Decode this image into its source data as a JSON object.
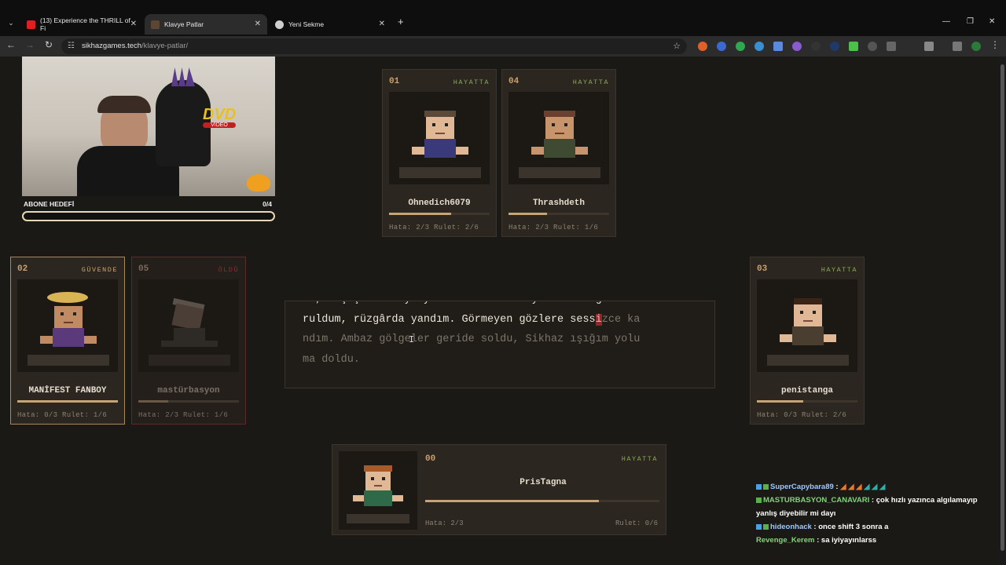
{
  "browser": {
    "tabs": [
      {
        "title": "(13) Experience the THRILL of Fi",
        "active": false,
        "favicon_color": "#e02020"
      },
      {
        "title": "Klavye Patlar",
        "active": true,
        "favicon_color": "#5a4632"
      },
      {
        "title": "Yeni Sekme",
        "active": false,
        "favicon_color": "#cfcfcf"
      }
    ],
    "url_host": "sikhazgames.tech",
    "url_path": "/klavye-patlar/"
  },
  "stream_overlay": {
    "goal_label": "ABONE HEDEFİ",
    "goal_count": "0/4",
    "goal_progress": 0,
    "dvd_text": "DVD",
    "dvd_sub": "VIDEO"
  },
  "players": [
    {
      "num": "01",
      "status": "HAYATTA",
      "name": "Ohnedich6079",
      "stats": "Hata: 2/3 Rulet: 2/6",
      "progress": 0.62,
      "state": "alive"
    },
    {
      "num": "04",
      "status": "HAYATTA",
      "name": "Thrashdeth",
      "stats": "Hata: 2/3 Rulet: 1/6",
      "progress": 0.38,
      "state": "alive"
    },
    {
      "num": "02",
      "status": "GÜVENDE",
      "name": "MANİFEST FANBOY",
      "stats": "Hata: 0/3 Rulet: 1/6",
      "progress": 1.0,
      "state": "safe"
    },
    {
      "num": "05",
      "status": "ÖLDÜ",
      "name": "mastürbasyon",
      "stats": "Hata: 2/3 Rulet: 1/6",
      "progress": 0.3,
      "state": "dead"
    },
    {
      "num": "03",
      "status": "HAYATTA",
      "name": "penistanga",
      "stats": "Hata: 0/3 Rulet: 2/6",
      "progress": 0.46,
      "state": "alive"
    }
  ],
  "self_player": {
    "num": "00",
    "status": "HAYATTA",
    "name": "PrisTagna",
    "hata": "Hata: 2/3",
    "rulet": "Rulet: 0/6",
    "progress": 0.74
  },
  "typing": {
    "line0": "ım, kaçışımla kaynayan sıkhazı bulmaya... Kül gibi sa.",
    "line1_typed": "ruldum, rüzgârda yandım. Görmeyen gözlere sess",
    "line1_cursor": "i",
    "line1_rest": "zce ka",
    "line2": "ndım. Ambaz gölgeler geride soldu, Sikhaz ışığım yolu",
    "line3": "ma doldu."
  },
  "chat": [
    {
      "user": "SuperCapybara89",
      "msg": " : ",
      "user_color": "#9ec8ff"
    },
    {
      "user": "MASTURBASYON_CANAVARI",
      "msg": " : çok hızlı yazınca algılamayıp yanlış diyebilir mi dayı",
      "user_color": "#7fd67a"
    },
    {
      "user": "hideonhack",
      "msg": " : once shift 3 sonra a",
      "user_color": "#9ec8ff"
    },
    {
      "user": "Revenge_Kerem",
      "msg": " : sa iyiyayınlarss",
      "user_color": "#7fd67a"
    }
  ]
}
